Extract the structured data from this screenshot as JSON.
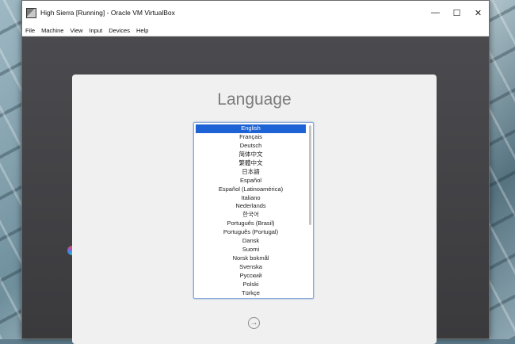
{
  "window": {
    "title": "High Sierra [Running] - Oracle VM VirtualBox",
    "controls": {
      "minimize": "—",
      "maximize": "☐",
      "close": "✕"
    }
  },
  "menubar": {
    "items": [
      "File",
      "Machine",
      "View",
      "Input",
      "Devices",
      "Help"
    ]
  },
  "installer": {
    "title": "Language",
    "selected_index": 0,
    "languages": [
      "English",
      "Français",
      "Deutsch",
      "简体中文",
      "繁體中文",
      "日本語",
      "Español",
      "Español (Latinoamérica)",
      "Italiano",
      "Nederlands",
      "한국어",
      "Português (Brasil)",
      "Português (Portugal)",
      "Dansk",
      "Suomi",
      "Norsk bokmål",
      "Svenska",
      "Русский",
      "Polski",
      "Türkçe"
    ],
    "continue_icon": "arrow-right-icon",
    "continue_glyph": "→"
  },
  "colors": {
    "selection": "#1d63d5",
    "installer_bg": "#f0f0f0",
    "vm_bg": "#3a3a3d"
  }
}
